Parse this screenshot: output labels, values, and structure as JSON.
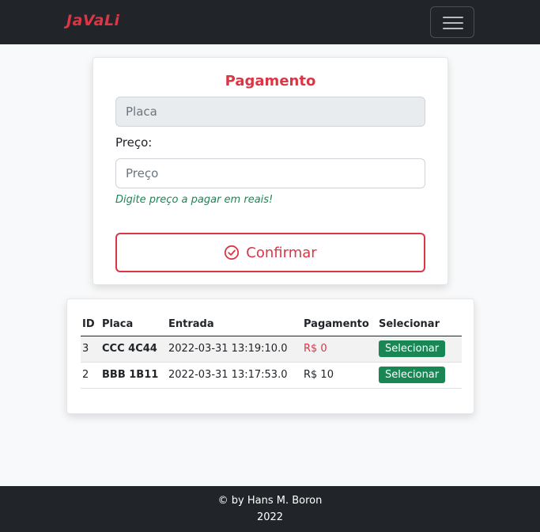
{
  "navbar": {
    "brand": "JaVaLi",
    "menu_icon": "hamburger-menu-icon"
  },
  "form": {
    "title": "Pagamento",
    "placa_placeholder": "Placa",
    "preco_label": "Preço:",
    "preco_placeholder": "Preço",
    "hint": "Digite preço a pagar em reais!",
    "confirm_icon": "check-circle-icon",
    "confirm_label": "Confirmar"
  },
  "table": {
    "headers": [
      "ID",
      "Placa",
      "Entrada",
      "Pagamento",
      "Selecionar"
    ],
    "rows": [
      {
        "id": "3",
        "placa": "CCC 4C44",
        "entrada": "2022-03-31 13:19:10.0",
        "pagamento": "R$ 0",
        "button": "Selecionar"
      },
      {
        "id": "2",
        "placa": "BBB 1B11",
        "entrada": "2022-03-31 13:17:53.0",
        "pagamento": "R$ 10",
        "button": "Selecionar"
      }
    ]
  },
  "footer": {
    "line1": "© by Hans M. Boron",
    "line2": "2022"
  },
  "colors": {
    "accent": "#dc3545",
    "success": "#198754",
    "dark": "#212529"
  }
}
